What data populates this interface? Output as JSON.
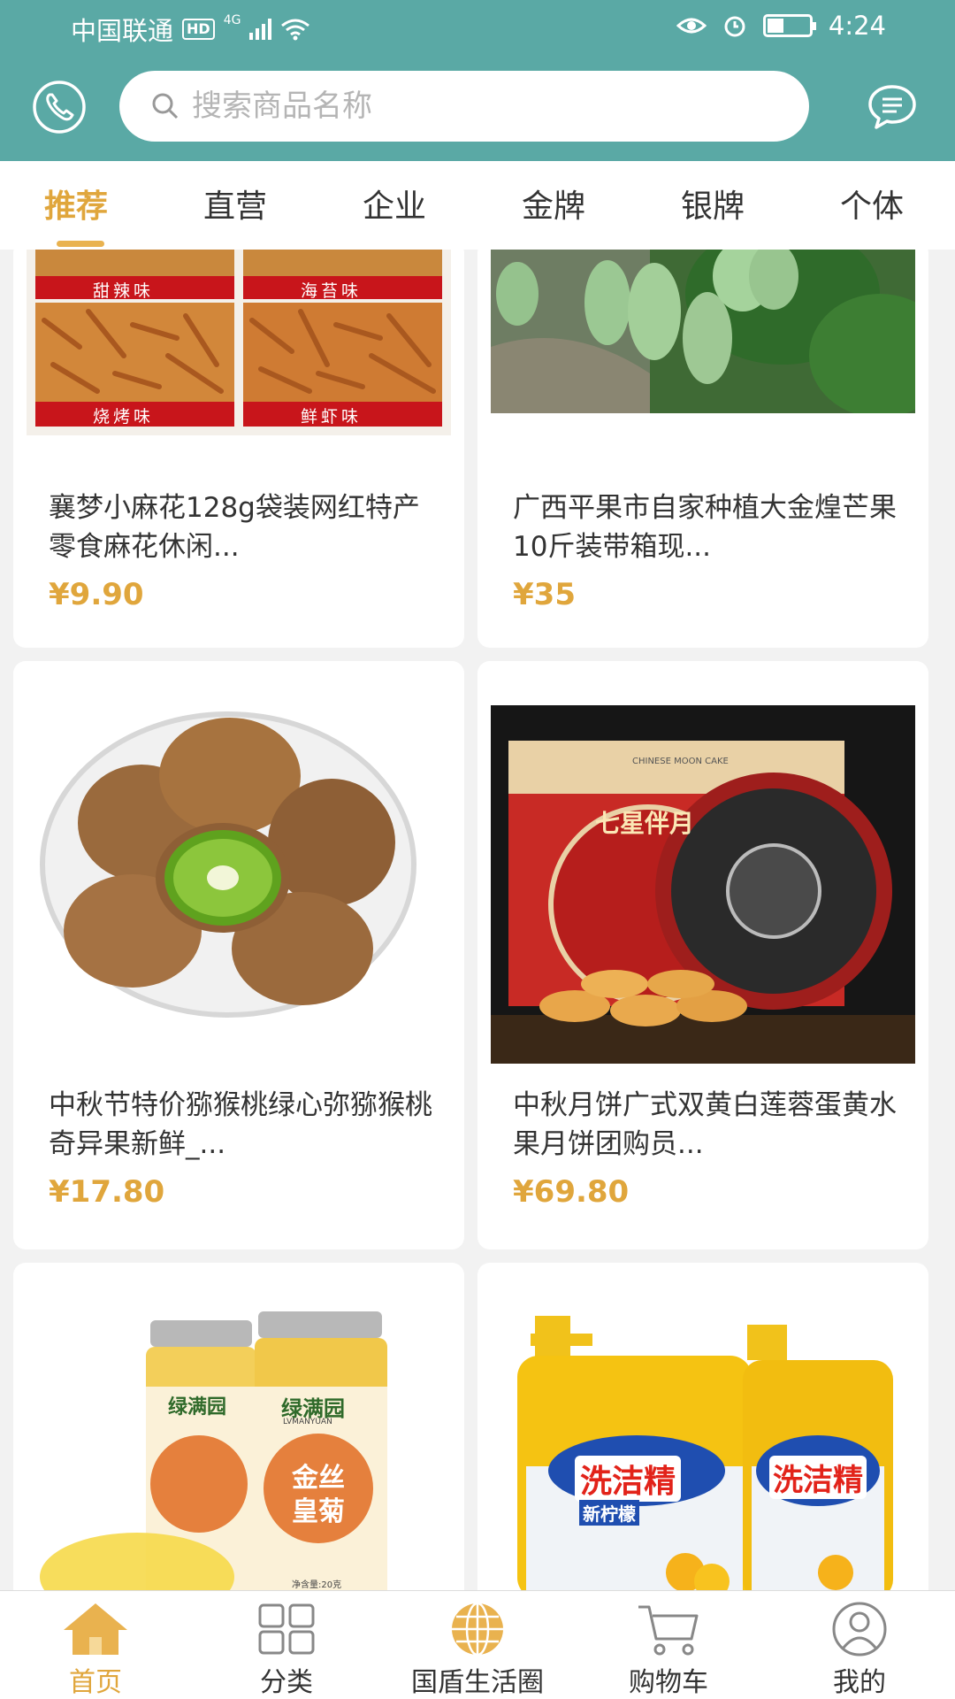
{
  "status": {
    "carrier": "中国联通",
    "hd": "HD",
    "network": "4G",
    "time": "4:24"
  },
  "header": {
    "search_placeholder": "搜索商品名称"
  },
  "tabs": [
    {
      "label": "推荐",
      "active": true
    },
    {
      "label": "直营"
    },
    {
      "label": "企业"
    },
    {
      "label": "金牌"
    },
    {
      "label": "银牌"
    },
    {
      "label": "个体"
    }
  ],
  "products": [
    {
      "title": "襄梦小麻花128g袋装网红特产零食麻花休闲...",
      "price": "¥9.90",
      "image_labels": [
        "甜辣味",
        "海苔味",
        "烧烤味",
        "鲜虾味"
      ]
    },
    {
      "title": "广西平果市自家种植大金煌芒果10斤装带箱现...",
      "price": "¥35"
    },
    {
      "title": "中秋节特价猕猴桃绿心弥猕猴桃奇异果新鲜_...",
      "price": "¥17.80"
    },
    {
      "title": "中秋月饼广式双黄白莲蓉蛋黄水果月饼团购员...",
      "price": "¥69.80",
      "image_labels": [
        "七星伴月",
        "CHINESE MOON CAKE"
      ]
    },
    {
      "title": "",
      "price": "",
      "image_labels": [
        "绿满园",
        "LVMANYUAN",
        "金丝皇菊",
        "净含量:20克"
      ]
    },
    {
      "title": "",
      "price": "",
      "image_labels": [
        "洗洁精",
        "新柠檬"
      ]
    }
  ],
  "bottom_nav": [
    {
      "label": "首页",
      "icon": "home-icon",
      "active": true
    },
    {
      "label": "分类",
      "icon": "category-icon"
    },
    {
      "label": "国盾生活圈",
      "icon": "globe-icon"
    },
    {
      "label": "购物车",
      "icon": "cart-icon"
    },
    {
      "label": "我的",
      "icon": "profile-icon"
    }
  ],
  "colors": {
    "header": "#5aa9a5",
    "accent": "#e0a63c"
  }
}
